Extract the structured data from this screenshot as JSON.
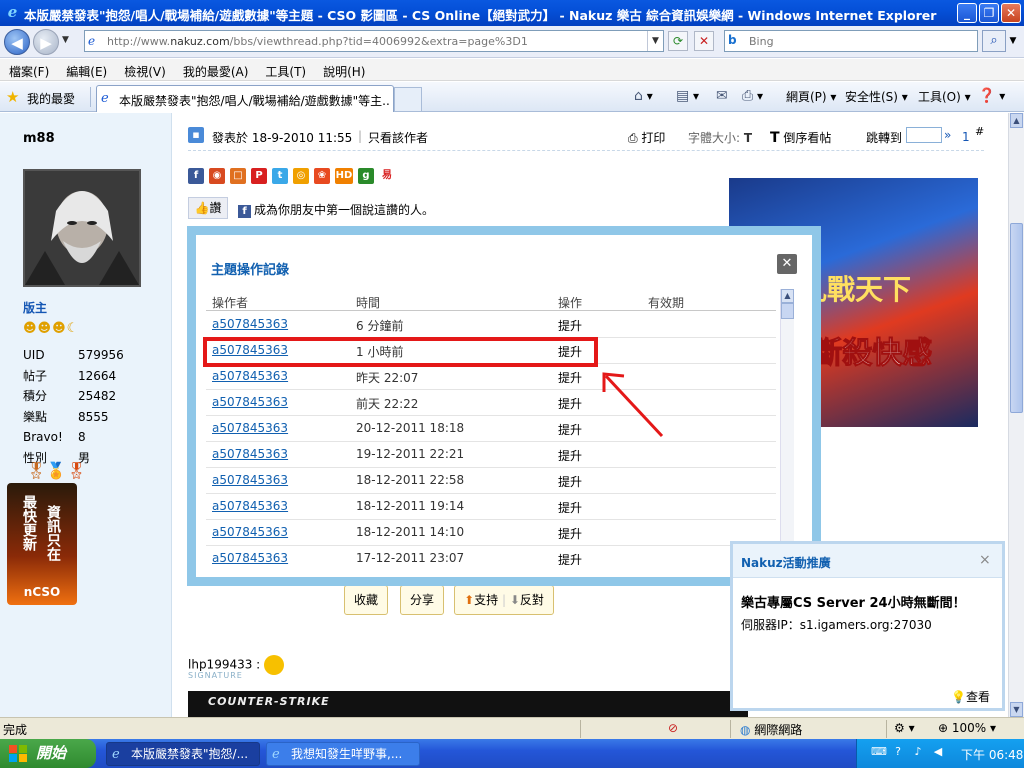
{
  "window": {
    "title": "本版嚴禁發表\"抱怨/唱人/戰場補給/遊戲數據\"等主題 - CSO 影圖區 - CS Online【絕對武力】 - Nakuz 樂古 綜合資訊娛樂網 - Windows Internet Explorer",
    "minimize": "_",
    "maximize": "❐",
    "close": "✕"
  },
  "address": {
    "url_prefix": "http://www.",
    "url_domain": "nakuz.com",
    "url_rest": "/bbs/viewthread.php?tid=4006992&extra=page%3D1",
    "search_placeholder": "Bing"
  },
  "menu": [
    "檔案(F)",
    "編輯(E)",
    "檢視(V)",
    "我的最愛(A)",
    "工具(T)",
    "說明(H)"
  ],
  "favorites_label": "我的最愛",
  "tab": {
    "title": "本版嚴禁發表\"抱怨/唱人/戰場補給/遊戲數據\"等主..."
  },
  "command_bar": {
    "page": "網頁(P)",
    "safety": "安全性(S)",
    "tools": "工具(O)"
  },
  "user": {
    "name": "m88",
    "rank": "版主",
    "stats": [
      {
        "k": "UID",
        "v": "579956"
      },
      {
        "k": "帖子",
        "v": "12664"
      },
      {
        "k": "積分",
        "v": "25482"
      },
      {
        "k": "樂點",
        "v": "8555"
      },
      {
        "k": "Bravo!",
        "v": "8"
      },
      {
        "k": "性別",
        "v": "男"
      }
    ]
  },
  "promo": {
    "col1": "最快更新",
    "col2": "資訊只在",
    "brand": "nCSO"
  },
  "post": {
    "date": "發表於 18-9-2010 11:55",
    "author_only": "只看該作者",
    "print": "打印",
    "font_size": "字體大小:",
    "font_t": "T",
    "reverse": "倒序看帖",
    "jump": "跳轉到",
    "jump_arrows": "»",
    "page": "1",
    "hash": "#"
  },
  "like": {
    "button": "讚",
    "text": "成為你朋友中第一個說這讚的人。"
  },
  "dialog": {
    "title": "主題操作記錄",
    "close": "✕",
    "headers": [
      "操作者",
      "時間",
      "操作",
      "有效期"
    ],
    "rows": [
      {
        "user": "a507845363",
        "time": "6 分鐘前",
        "action": "提升"
      },
      {
        "user": "a507845363",
        "time": "1 小時前",
        "action": "提升"
      },
      {
        "user": "a507845363",
        "time": "昨天 22:07",
        "action": "提升"
      },
      {
        "user": "a507845363",
        "time": "前天 22:22",
        "action": "提升"
      },
      {
        "user": "a507845363",
        "time": "20-12-2011 18:18",
        "action": "提升"
      },
      {
        "user": "a507845363",
        "time": "19-12-2011 22:21",
        "action": "提升"
      },
      {
        "user": "a507845363",
        "time": "18-12-2011 22:58",
        "action": "提升"
      },
      {
        "user": "a507845363",
        "time": "18-12-2011 19:14",
        "action": "提升"
      },
      {
        "user": "a507845363",
        "time": "18-12-2011 14:10",
        "action": "提升"
      },
      {
        "user": "a507845363",
        "time": "17-12-2011 23:07",
        "action": "提升"
      }
    ]
  },
  "actions": {
    "collect": "收藏",
    "share": "分享",
    "support": "支持",
    "oppose": "反對"
  },
  "signature": {
    "user": "lhp199433 :",
    "label": "SIGNATURE",
    "banner": "COUNTER-STRIKE"
  },
  "notice": {
    "title": "Nakuz活動推廣",
    "close": "×",
    "line1": "樂古專屬CS Server 24小時無斷間！",
    "line2": "伺服器IP：s1.igamers.org:27030",
    "view": "查看"
  },
  "status": {
    "done": "完成",
    "zone": "網際網路",
    "zoom": "100%"
  },
  "taskbar": {
    "start": "開始",
    "tasks": [
      "本版嚴禁發表\"抱怨/...",
      "我想知發生咩野事,..."
    ],
    "clock": "下午 06:48"
  }
}
